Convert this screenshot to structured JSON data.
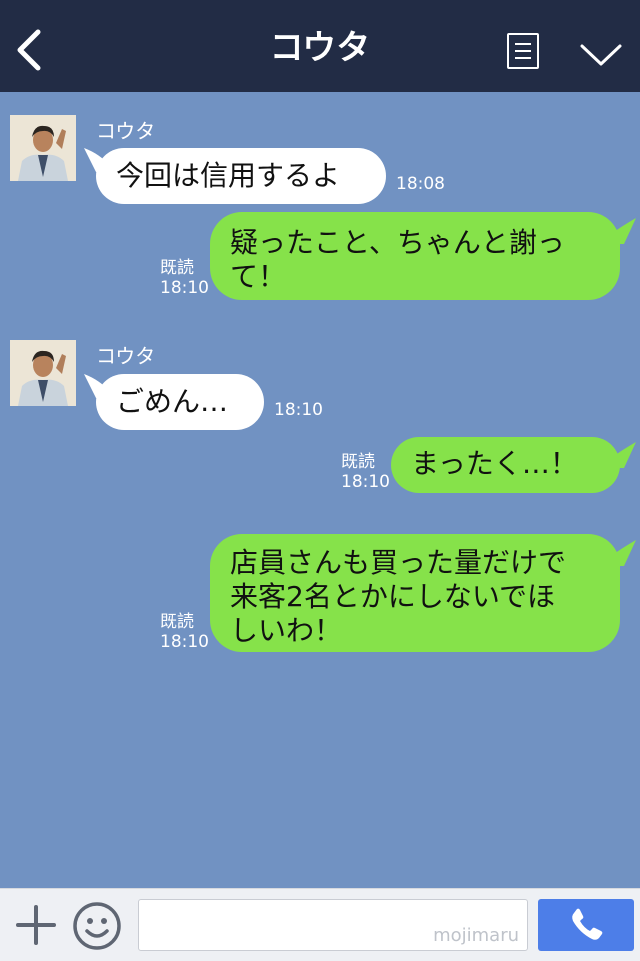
{
  "header": {
    "title": "コウタ"
  },
  "messages": [
    {
      "sender": "コウタ",
      "text": "今回は信用するよ",
      "time": "18:08"
    },
    {
      "text_line1": "疑ったこと、ちゃんと謝っ",
      "text_line2": "て！",
      "read_label": "既読",
      "time": "18:10"
    },
    {
      "sender": "コウタ",
      "text": "ごめん…",
      "time": "18:10"
    },
    {
      "text": "まったく…！",
      "read_label": "既読",
      "time": "18:10"
    },
    {
      "text_line1": "店員さんも買った量だけで",
      "text_line2": "来客2名とかにしないでほ",
      "text_line3": "しいわ！",
      "read_label": "既読",
      "time": "18:10"
    }
  ],
  "footer": {
    "watermark": "mojimaru"
  },
  "colors": {
    "header_bg": "#222c45",
    "chat_bg": "#7192c2",
    "outgoing_bubble": "#86e24a",
    "incoming_bubble": "#ffffff",
    "call_button": "#4d7ee8"
  },
  "icons": [
    "back-arrow-icon",
    "menu-icon",
    "chevron-down-icon",
    "avatar",
    "plus-icon",
    "emoji-icon",
    "phone-icon"
  ]
}
